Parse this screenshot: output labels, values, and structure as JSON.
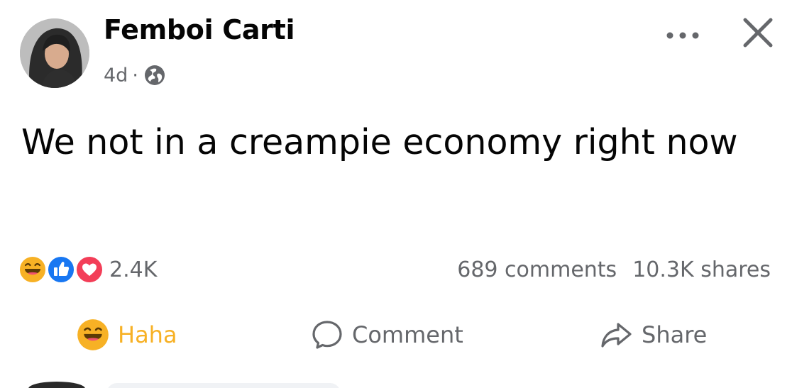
{
  "post": {
    "author": "Femboi Carti",
    "time": "4d",
    "separator": "·",
    "privacy_icon": "globe-icon",
    "text": "We not in a creampie economy right now"
  },
  "header_actions": {
    "more_icon": "more-horizontal-icon",
    "close_icon": "close-icon"
  },
  "reactions": {
    "icons": [
      "haha-reaction-icon",
      "like-reaction-icon",
      "love-reaction-icon"
    ],
    "count": "2.4K"
  },
  "stats": {
    "comments": "689 comments",
    "shares": "10.3K shares"
  },
  "actions": {
    "haha_label": "Haha",
    "comment_label": "Comment",
    "share_label": "Share"
  },
  "colors": {
    "haha": "#f7b125",
    "like": "#1877f2",
    "love": "#f33e58",
    "secondary_text": "#65676b"
  }
}
